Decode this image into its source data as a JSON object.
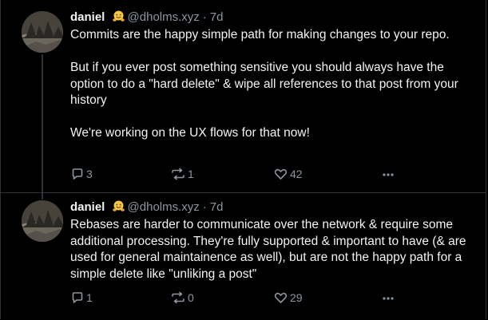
{
  "posts": [
    {
      "author": {
        "display_name": "daniel",
        "emoji": "hugging-face-emoji",
        "handle": "@dholms.xyz"
      },
      "separator": "·",
      "time": "7d",
      "paragraphs": [
        "Commits are the happy simple path for making changes to your repo.",
        "But if you ever post something sensitive you should always have the option to do a \"hard delete\" & wipe all references to that post from your history",
        "We're working on the UX flows for that now!"
      ],
      "counts": {
        "replies": "3",
        "reposts": "1",
        "likes": "42"
      }
    },
    {
      "author": {
        "display_name": "daniel",
        "emoji": "hugging-face-emoji",
        "handle": "@dholms.xyz"
      },
      "separator": "·",
      "time": "7d",
      "paragraphs": [
        "Rebases are harder to communicate over the network & require some additional processing. They're fully supported & important to have (& are used for general maintainence as well), but are not the happy path for a simple delete like \"unliking a post\""
      ],
      "counts": {
        "replies": "1",
        "reposts": "0",
        "likes": "29"
      }
    }
  ],
  "icons": {
    "reply": "speech-bubble-icon",
    "repost": "repost-arrows-icon",
    "like": "heart-icon",
    "more": "ellipsis-icon"
  },
  "colors": {
    "background": "#000000",
    "text": "#f1f3f5",
    "muted": "#8d96a0",
    "border": "#2e3238",
    "emoji": "#f7c744"
  }
}
